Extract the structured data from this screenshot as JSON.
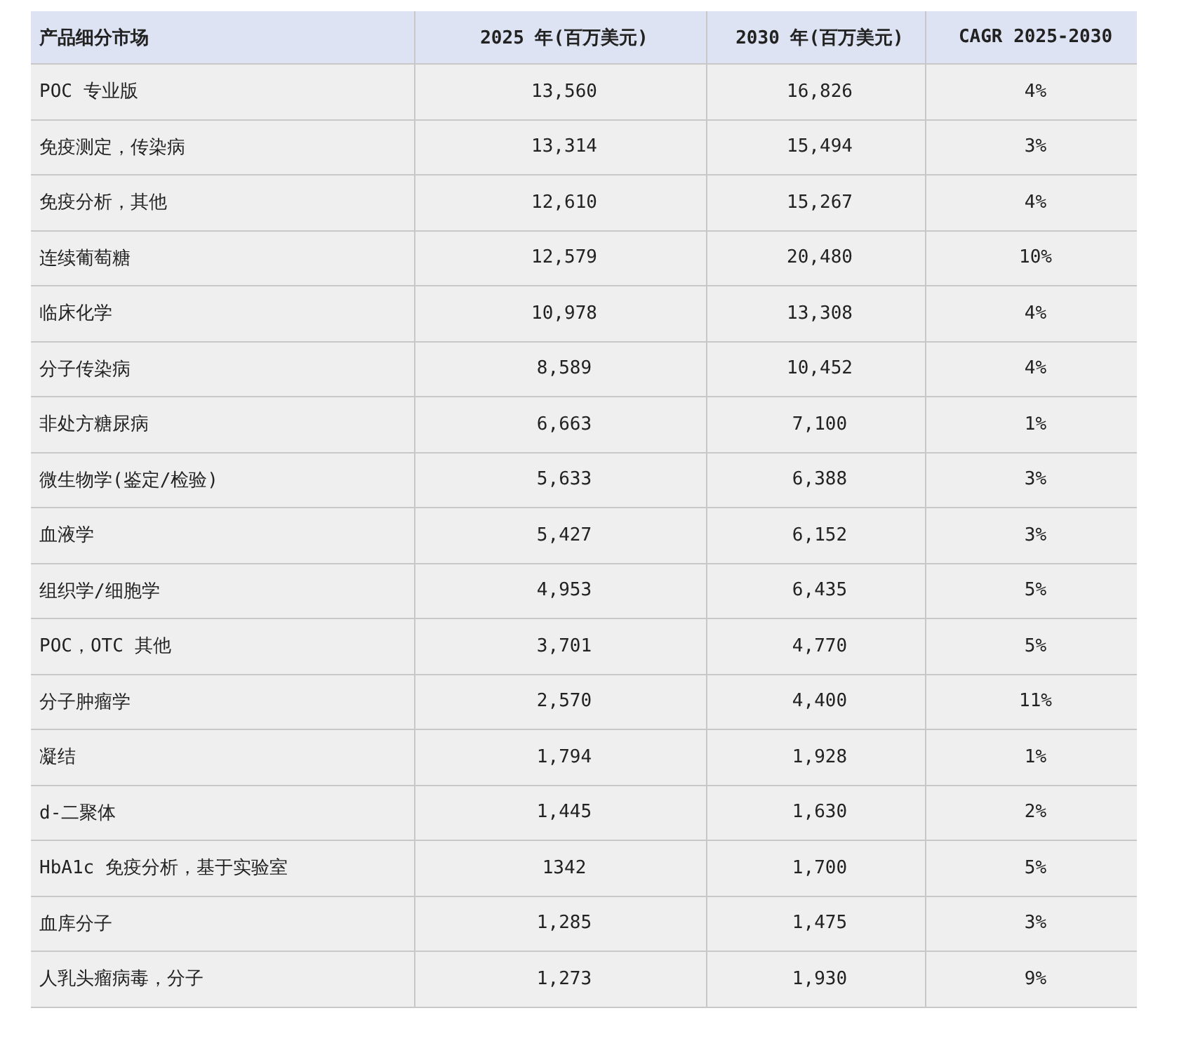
{
  "table": {
    "columns": [
      "产品细分市场",
      "2025 年(百万美元)",
      "2030 年(百万美元)",
      "CAGR 2025-2030"
    ],
    "rows": [
      [
        "POC 专业版",
        "13,560",
        "16,826",
        "4%"
      ],
      [
        "免疫测定，传染病",
        "13,314",
        "15,494",
        "3%"
      ],
      [
        "免疫分析，其他",
        "12,610",
        "15,267",
        "4%"
      ],
      [
        "连续葡萄糖",
        "12,579",
        "20,480",
        "10%"
      ],
      [
        "临床化学",
        "10,978",
        "13,308",
        "4%"
      ],
      [
        "分子传染病",
        "8,589",
        "10,452",
        "4%"
      ],
      [
        "非处方糖尿病",
        "6,663",
        "7,100",
        "1%"
      ],
      [
        "微生物学(鉴定/检验)",
        "5,633",
        "6,388",
        "3%"
      ],
      [
        "血液学",
        "5,427",
        "6,152",
        "3%"
      ],
      [
        "组织学/细胞学",
        "4,953",
        "6,435",
        "5%"
      ],
      [
        "POC，OTC 其他",
        "3,701",
        "4,770",
        "5%"
      ],
      [
        "分子肿瘤学",
        "2,570",
        "4,400",
        "11%"
      ],
      [
        "凝结",
        "1,794",
        "1,928",
        "1%"
      ],
      [
        "d-二聚体",
        "1,445",
        "1,630",
        "2%"
      ],
      [
        "HbA1c 免疫分析，基于实验室",
        "1342",
        "1,700",
        "5%"
      ],
      [
        "血库分子",
        "1,285",
        "1,475",
        "3%"
      ],
      [
        "人乳头瘤病毒，分子",
        "1,273",
        "1,930",
        "9%"
      ]
    ]
  }
}
